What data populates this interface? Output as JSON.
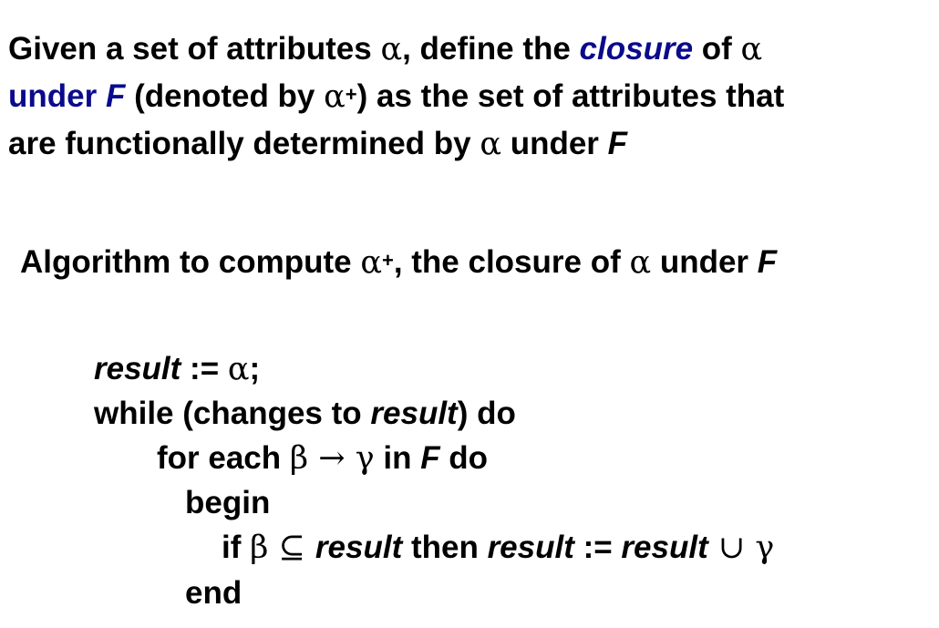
{
  "definition": {
    "line1": {
      "a": "Given a set of attributes ",
      "alpha": "α",
      "b": ", define the ",
      "closure": "closure",
      "c": " of ",
      "alpha2": "α"
    },
    "line2": {
      "under": "under ",
      "F": "F",
      "a": " (denoted by ",
      "alpha": "α",
      "plus": "+",
      "b": ") as the set of attributes that"
    },
    "line3": {
      "a": "are functionally determined by ",
      "alpha": "α",
      "b": " under ",
      "F": "F"
    }
  },
  "heading": {
    "a": "Algorithm to compute ",
    "alpha": "α",
    "plus": "+",
    "b": ", the closure of ",
    "alpha2": "α",
    "c": " under ",
    "F": "F"
  },
  "algorithm": {
    "line1": {
      "result": "result",
      "assign": " := ",
      "alpha": "α",
      "semi": ";"
    },
    "line2": {
      "a": "while (changes to ",
      "result": "result",
      "b": ") do"
    },
    "line3": {
      "a": "for each ",
      "beta": "β",
      "arrow": " → ",
      "gamma": "γ",
      "b": " in ",
      "F": "F",
      "c": " do"
    },
    "line4": {
      "a": "begin"
    },
    "line5": {
      "a": "if ",
      "beta": "β",
      "subset": " ⊆ ",
      "result": "result",
      "b": " then  ",
      "result2": "result",
      "assign": " := ",
      "result3": "result",
      "union": " ∪ ",
      "gamma": "γ"
    },
    "line6": {
      "a": "end"
    }
  },
  "colors": {
    "text": "#000000",
    "accent_blue": "#0a0a8c"
  }
}
